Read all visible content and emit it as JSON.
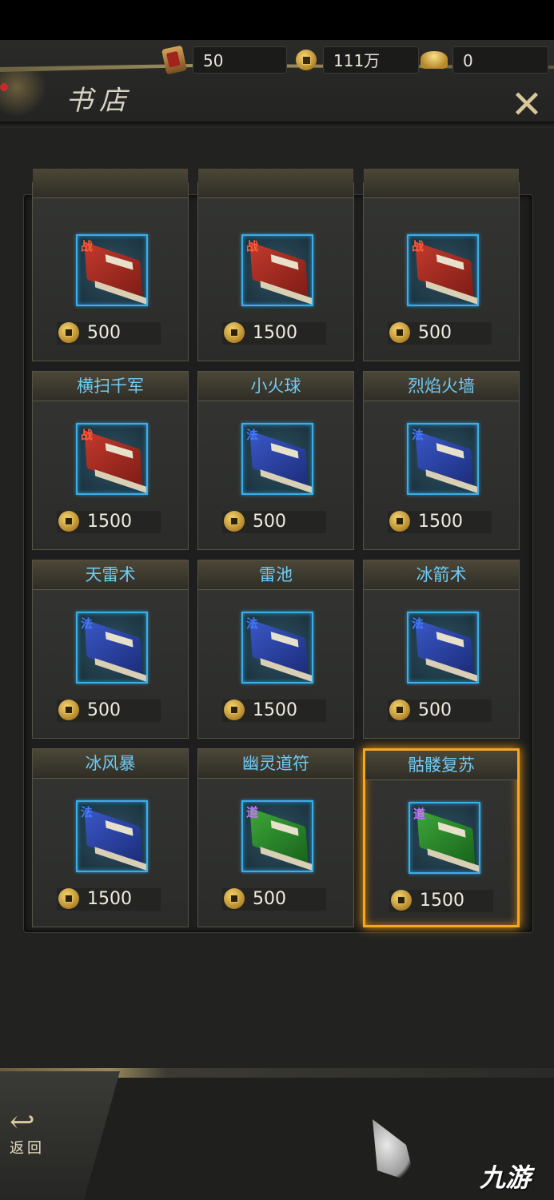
{
  "header": {
    "title": "书店",
    "currencies": [
      {
        "icon": "token-icon",
        "value": "50"
      },
      {
        "icon": "copper-coin-icon",
        "value": "111万"
      },
      {
        "icon": "gold-ingot-icon",
        "value": "0"
      }
    ]
  },
  "books": [
    {
      "name": "",
      "price": "500",
      "type": "战",
      "color": "red"
    },
    {
      "name": "",
      "price": "1500",
      "type": "战",
      "color": "red"
    },
    {
      "name": "",
      "price": "500",
      "type": "战",
      "color": "red"
    },
    {
      "name": "横扫千军",
      "price": "1500",
      "type": "战",
      "color": "red"
    },
    {
      "name": "小火球",
      "price": "500",
      "type": "法",
      "color": "blue"
    },
    {
      "name": "烈焰火墙",
      "price": "1500",
      "type": "法",
      "color": "blue"
    },
    {
      "name": "天雷术",
      "price": "500",
      "type": "法",
      "color": "blue"
    },
    {
      "name": "雷池",
      "price": "1500",
      "type": "法",
      "color": "blue"
    },
    {
      "name": "冰箭术",
      "price": "500",
      "type": "法",
      "color": "blue"
    },
    {
      "name": "冰风暴",
      "price": "1500",
      "type": "法",
      "color": "blue"
    },
    {
      "name": "幽灵道符",
      "price": "500",
      "type": "道",
      "color": "green"
    },
    {
      "name": "骷髅复苏",
      "price": "1500",
      "type": "道",
      "color": "green",
      "selected": true
    }
  ],
  "footer": {
    "back_label": "返回",
    "watermark": "九游"
  }
}
